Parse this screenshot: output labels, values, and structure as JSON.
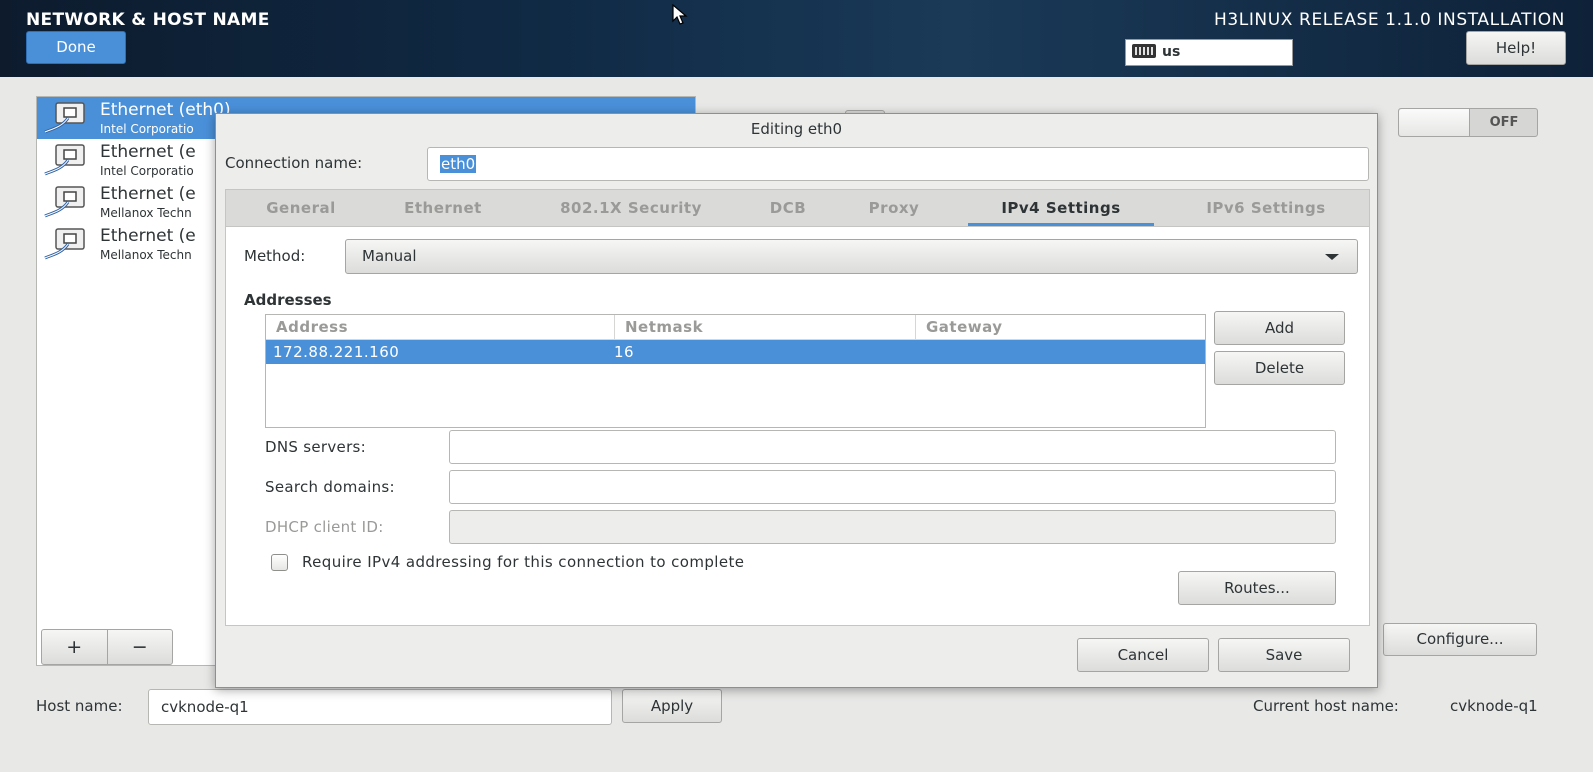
{
  "header": {
    "title": "NETWORK & HOST NAME",
    "product": "H3LINUX RELEASE 1.1.0 INSTALLATION",
    "done_label": "Done",
    "keyboard_layout": "us",
    "help_label": "Help!"
  },
  "interfaces": [
    {
      "name": "Ethernet (eth0)",
      "desc": "Intel Corporatio",
      "selected": true
    },
    {
      "name": "Ethernet (e",
      "desc": "Intel Corporatio",
      "selected": false
    },
    {
      "name": "Ethernet (e",
      "desc": "Mellanox Techn",
      "selected": false
    },
    {
      "name": "Ethernet (e",
      "desc": "Mellanox Techn",
      "selected": false
    }
  ],
  "list_controls": {
    "add": "+",
    "remove": "−"
  },
  "toggle": {
    "state_label": "OFF"
  },
  "configure_label": "Configure...",
  "hostname": {
    "label": "Host name:",
    "value": "cvknode-q1",
    "apply_label": "Apply",
    "current_label": "Current host name:",
    "current_value": "cvknode-q1"
  },
  "dialog": {
    "title": "Editing eth0",
    "connection_name_label": "Connection name:",
    "connection_name_value": "eth0",
    "tabs": [
      "General",
      "Ethernet",
      "802.1X Security",
      "DCB",
      "Proxy",
      "IPv4 Settings",
      "IPv6 Settings"
    ],
    "active_tab": "IPv4 Settings",
    "method_label": "Method:",
    "method_value": "Manual",
    "addresses_heading": "Addresses",
    "columns": [
      "Address",
      "Netmask",
      "Gateway"
    ],
    "rows": [
      {
        "address": "172.88.221.160",
        "netmask": "16",
        "gateway": ""
      }
    ],
    "add_label": "Add",
    "delete_label": "Delete",
    "dns_label": "DNS servers:",
    "dns_value": "",
    "search_label": "Search domains:",
    "search_value": "",
    "dhcp_label": "DHCP client ID:",
    "dhcp_value": "",
    "require_label": "Require IPv4 addressing for this connection to complete",
    "routes_label": "Routes...",
    "cancel_label": "Cancel",
    "save_label": "Save"
  },
  "colors": {
    "accent": "#4a90d9",
    "header_bg": "#102a45",
    "window_bg": "#e8e8e7"
  }
}
